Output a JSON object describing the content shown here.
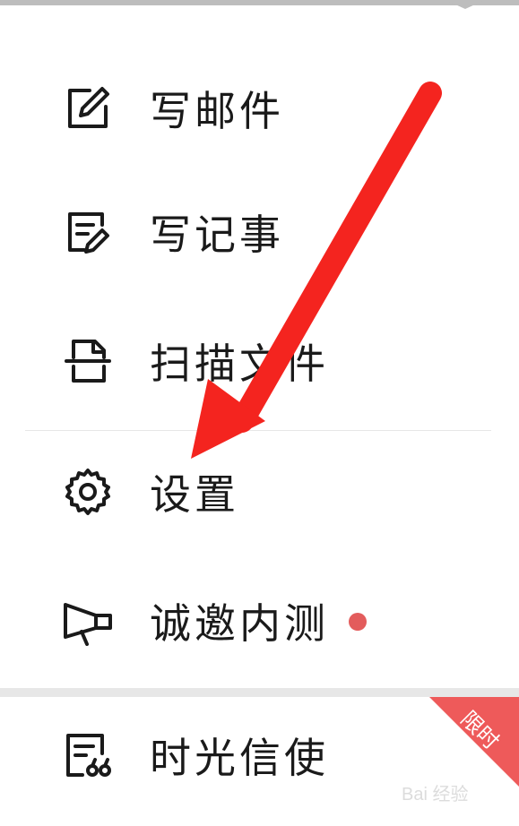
{
  "menu": {
    "items": [
      {
        "label": "写邮件",
        "icon": "compose-mail-icon"
      },
      {
        "label": "写记事",
        "icon": "compose-note-icon"
      },
      {
        "label": "扫描文件",
        "icon": "scan-document-icon"
      },
      {
        "label": "设置",
        "icon": "gear-icon"
      },
      {
        "label": "诚邀内测",
        "icon": "megaphone-icon"
      },
      {
        "label": "时光信使",
        "icon": "time-letter-icon"
      }
    ],
    "badge_text": "限时"
  },
  "watermark": "Bai 经验",
  "colors": {
    "arrow": "#f4241f",
    "badge": "#ee5a5a",
    "dot": "#e35c5c"
  }
}
